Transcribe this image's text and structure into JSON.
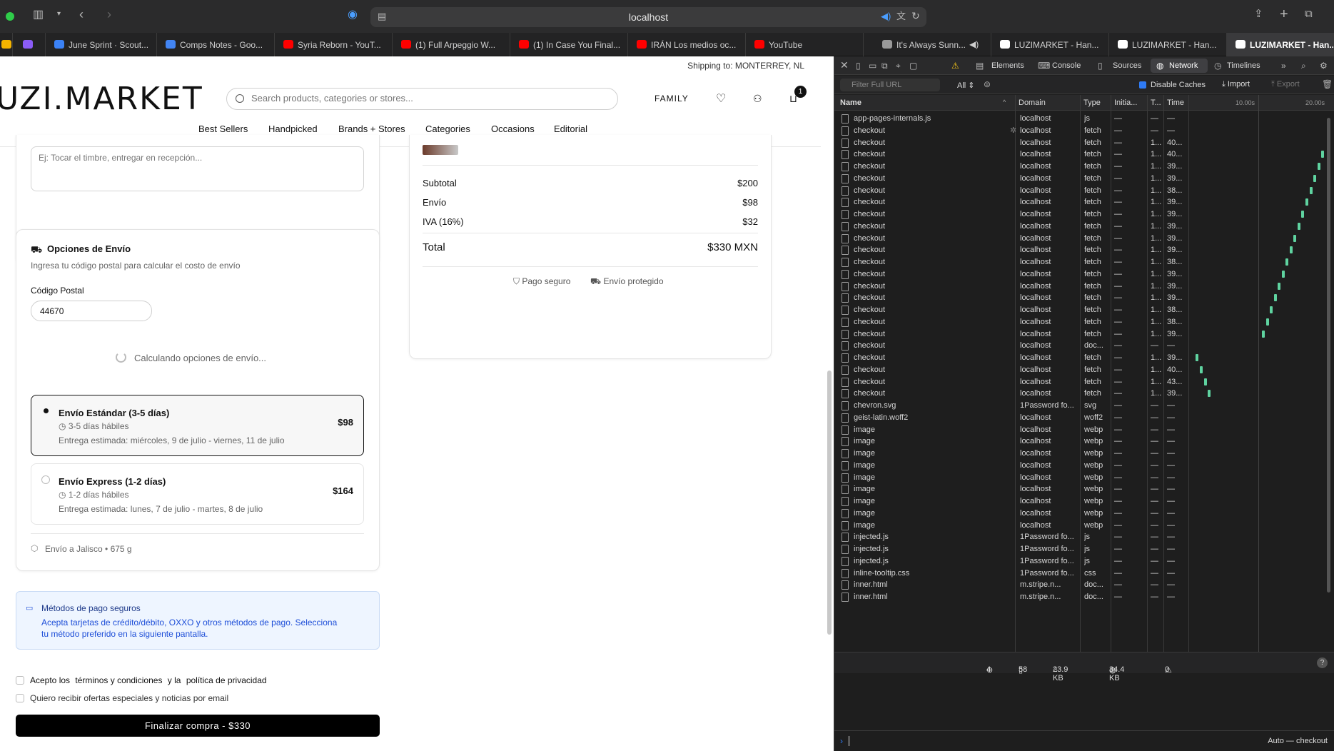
{
  "browser": {
    "url": "localhost",
    "tabs": [
      {
        "label": "June Sprint · Scout...",
        "color": "#3b82f6"
      },
      {
        "label": "Comps Notes - Goo...",
        "color": "#4285f4"
      },
      {
        "label": "Syria Reborn - YouT...",
        "color": "#ff0000"
      },
      {
        "label": "(1) Full Arpeggio W...",
        "color": "#ff0000"
      },
      {
        "label": "(1) In Case You Final...",
        "color": "#ff0000"
      },
      {
        "label": "IRÁN Los medios oc...",
        "color": "#ff0000"
      },
      {
        "label": "YouTube",
        "color": "#ff0000"
      },
      {
        "label": "It's Always Sunn...",
        "color": "#9a9a9a"
      },
      {
        "label": "LUZIMARKET - Han...",
        "color": "#ffffff"
      },
      {
        "label": "LUZIMARKET - Han...",
        "color": "#ffffff"
      },
      {
        "label": "LUZIMARKET - Han...",
        "color": "#ffffff"
      }
    ]
  },
  "site": {
    "shipping_to": "Shipping to: MONTERREY, NL",
    "logo": "UZI.MARKET",
    "search_placeholder": "Search products, categories or stores...",
    "family_label": "FAMILY",
    "cart_count": "1",
    "nav": [
      "Best Sellers",
      "Handpicked",
      "Brands + Stores",
      "Categories",
      "Occasions",
      "Editorial"
    ]
  },
  "checkout": {
    "notes_placeholder": "Ej: Tocar el timbre, entregar en recepción...",
    "shipping": {
      "title": "Opciones de Envío",
      "subtitle": "Ingresa tu código postal para calcular el costo de envío",
      "zip_label": "Código Postal",
      "zip_value": "44670",
      "calculating": "Calculando opciones de envío...",
      "options": [
        {
          "title": "Envío Estándar (3-5 días)",
          "days": "3-5 días hábiles",
          "estimate": "Entrega estimada: miércoles, 9 de julio - viernes, 11 de julio",
          "price": "$98",
          "selected": true
        },
        {
          "title": "Envío Express (1-2 días)",
          "days": "1-2 días hábiles",
          "estimate": "Entrega estimada: lunes, 7 de julio - martes, 8 de julio",
          "price": "$164",
          "selected": false
        }
      ],
      "footer": "Envío a Jalisco • 675 g"
    },
    "secure": {
      "title": "Métodos de pago seguros",
      "body_line1": "Acepta tarjetas de crédito/débito, OXXO y otros métodos de pago. Selecciona",
      "body_line2": "tu método preferido en la siguiente pantalla."
    },
    "terms": {
      "prefix": "Acepto los",
      "terms_link": "términos y condiciones",
      "and": "y la",
      "privacy_link": "política de privacidad"
    },
    "offers": "Quiero recibir ofertas especiales y noticias por email",
    "buy_button": "Finalizar compra - $330"
  },
  "summary": {
    "rows": [
      {
        "label": "Subtotal",
        "value": "$200"
      },
      {
        "label": "Envío",
        "value": "$98"
      },
      {
        "label": "IVA (16%)",
        "value": "$32"
      }
    ],
    "total_label": "Total",
    "total_value": "$330 MXN",
    "badge_secure": "Pago seguro",
    "badge_protected": "Envío protegido"
  },
  "devtools": {
    "tabs": [
      "Elements",
      "Console",
      "Sources",
      "Network",
      "Timelines"
    ],
    "active_tab": "Network",
    "filter_placeholder": "Filter Full URL",
    "filter_all": "All",
    "disable_caches": "Disable Caches",
    "import": "Import",
    "export": "Export",
    "columns": [
      "Name",
      "Domain",
      "Type",
      "Initia...",
      "T...",
      "Time"
    ],
    "timeline_ticks": [
      "10.00s",
      "20.00s"
    ],
    "requests": [
      {
        "name": "app-pages-internals.js",
        "domain": "localhost",
        "type": "js",
        "initiator": "—",
        "t": "—",
        "time": "—",
        "bar": null
      },
      {
        "name": "checkout",
        "domain": "localhost",
        "type": "fetch",
        "initiator": "—",
        "t": "—",
        "time": "—",
        "bar": null,
        "spinner": true
      },
      {
        "name": "checkout",
        "domain": "localhost",
        "type": "fetch",
        "initiator": "—",
        "t": "1...",
        "time": "40...",
        "bar": null
      },
      {
        "name": "checkout",
        "domain": "localhost",
        "type": "fetch",
        "initiator": "—",
        "t": "1...",
        "time": "40...",
        "bar": 0.985
      },
      {
        "name": "checkout",
        "domain": "localhost",
        "type": "fetch",
        "initiator": "—",
        "t": "1...",
        "time": "39...",
        "bar": 0.955
      },
      {
        "name": "checkout",
        "domain": "localhost",
        "type": "fetch",
        "initiator": "—",
        "t": "1...",
        "time": "39...",
        "bar": 0.925
      },
      {
        "name": "checkout",
        "domain": "localhost",
        "type": "fetch",
        "initiator": "—",
        "t": "1...",
        "time": "38...",
        "bar": 0.895
      },
      {
        "name": "checkout",
        "domain": "localhost",
        "type": "fetch",
        "initiator": "—",
        "t": "1...",
        "time": "39...",
        "bar": 0.865
      },
      {
        "name": "checkout",
        "domain": "localhost",
        "type": "fetch",
        "initiator": "—",
        "t": "1...",
        "time": "39...",
        "bar": 0.835
      },
      {
        "name": "checkout",
        "domain": "localhost",
        "type": "fetch",
        "initiator": "—",
        "t": "1...",
        "time": "39...",
        "bar": 0.805
      },
      {
        "name": "checkout",
        "domain": "localhost",
        "type": "fetch",
        "initiator": "—",
        "t": "1...",
        "time": "39...",
        "bar": 0.775
      },
      {
        "name": "checkout",
        "domain": "localhost",
        "type": "fetch",
        "initiator": "—",
        "t": "1...",
        "time": "39...",
        "bar": 0.745
      },
      {
        "name": "checkout",
        "domain": "localhost",
        "type": "fetch",
        "initiator": "—",
        "t": "1...",
        "time": "38...",
        "bar": 0.715
      },
      {
        "name": "checkout",
        "domain": "localhost",
        "type": "fetch",
        "initiator": "—",
        "t": "1...",
        "time": "39...",
        "bar": 0.685
      },
      {
        "name": "checkout",
        "domain": "localhost",
        "type": "fetch",
        "initiator": "—",
        "t": "1...",
        "time": "39...",
        "bar": 0.655
      },
      {
        "name": "checkout",
        "domain": "localhost",
        "type": "fetch",
        "initiator": "—",
        "t": "1...",
        "time": "39...",
        "bar": 0.625
      },
      {
        "name": "checkout",
        "domain": "localhost",
        "type": "fetch",
        "initiator": "—",
        "t": "1...",
        "time": "38...",
        "bar": 0.595
      },
      {
        "name": "checkout",
        "domain": "localhost",
        "type": "fetch",
        "initiator": "—",
        "t": "1...",
        "time": "38...",
        "bar": 0.565
      },
      {
        "name": "checkout",
        "domain": "localhost",
        "type": "fetch",
        "initiator": "—",
        "t": "1...",
        "time": "39...",
        "bar": 0.535
      },
      {
        "name": "checkout",
        "domain": "localhost",
        "type": "doc...",
        "initiator": "—",
        "t": "—",
        "time": "—",
        "bar": null
      },
      {
        "name": "checkout",
        "domain": "localhost",
        "type": "fetch",
        "initiator": "—",
        "t": "1...",
        "time": "39...",
        "bar": 0.035
      },
      {
        "name": "checkout",
        "domain": "localhost",
        "type": "fetch",
        "initiator": "—",
        "t": "1...",
        "time": "40...",
        "bar": 0.065
      },
      {
        "name": "checkout",
        "domain": "localhost",
        "type": "fetch",
        "initiator": "—",
        "t": "1...",
        "time": "43...",
        "bar": 0.095
      },
      {
        "name": "checkout",
        "domain": "localhost",
        "type": "fetch",
        "initiator": "—",
        "t": "1...",
        "time": "39...",
        "bar": 0.125
      },
      {
        "name": "chevron.svg",
        "domain": "1Password fo...",
        "type": "svg",
        "initiator": "—",
        "t": "—",
        "time": "—",
        "bar": null
      },
      {
        "name": "geist-latin.woff2",
        "domain": "localhost",
        "type": "woff2",
        "initiator": "—",
        "t": "—",
        "time": "—",
        "bar": null
      },
      {
        "name": "image",
        "domain": "localhost",
        "type": "webp",
        "initiator": "—",
        "t": "—",
        "time": "—",
        "bar": null
      },
      {
        "name": "image",
        "domain": "localhost",
        "type": "webp",
        "initiator": "—",
        "t": "—",
        "time": "—",
        "bar": null
      },
      {
        "name": "image",
        "domain": "localhost",
        "type": "webp",
        "initiator": "—",
        "t": "—",
        "time": "—",
        "bar": null
      },
      {
        "name": "image",
        "domain": "localhost",
        "type": "webp",
        "initiator": "—",
        "t": "—",
        "time": "—",
        "bar": null
      },
      {
        "name": "image",
        "domain": "localhost",
        "type": "webp",
        "initiator": "—",
        "t": "—",
        "time": "—",
        "bar": null
      },
      {
        "name": "image",
        "domain": "localhost",
        "type": "webp",
        "initiator": "—",
        "t": "—",
        "time": "—",
        "bar": null
      },
      {
        "name": "image",
        "domain": "localhost",
        "type": "webp",
        "initiator": "—",
        "t": "—",
        "time": "—",
        "bar": null
      },
      {
        "name": "image",
        "domain": "localhost",
        "type": "webp",
        "initiator": "—",
        "t": "—",
        "time": "—",
        "bar": null
      },
      {
        "name": "image",
        "domain": "localhost",
        "type": "webp",
        "initiator": "—",
        "t": "—",
        "time": "—",
        "bar": null
      },
      {
        "name": "injected.js",
        "domain": "1Password fo...",
        "type": "js",
        "initiator": "—",
        "t": "—",
        "time": "—",
        "bar": null
      },
      {
        "name": "injected.js",
        "domain": "1Password fo...",
        "type": "js",
        "initiator": "—",
        "t": "—",
        "time": "—",
        "bar": null
      },
      {
        "name": "injected.js",
        "domain": "1Password fo...",
        "type": "js",
        "initiator": "—",
        "t": "—",
        "time": "—",
        "bar": null
      },
      {
        "name": "inline-tooltip.css",
        "domain": "1Password fo...",
        "type": "css",
        "initiator": "—",
        "t": "—",
        "time": "—",
        "bar": null
      },
      {
        "name": "inner.html",
        "domain": "m.stripe.n...",
        "type": "doc...",
        "initiator": "—",
        "t": "—",
        "time": "—",
        "bar": null
      },
      {
        "name": "inner.html",
        "domain": "m.stripe.n...",
        "type": "doc...",
        "initiator": "—",
        "t": "—",
        "time": "—",
        "bar": null
      }
    ],
    "status": {
      "requests": "4",
      "resources": "58",
      "transferred": "23.9 KB",
      "size": "34.4 KB",
      "errors": "0"
    },
    "console_target": "Auto — checkout"
  },
  "colors": {
    "accent_green": "#5fd3a0",
    "devtools_bg": "#1e1e1e",
    "secure_bg": "#eef5ff",
    "secure_text": "#1d4ed8"
  }
}
